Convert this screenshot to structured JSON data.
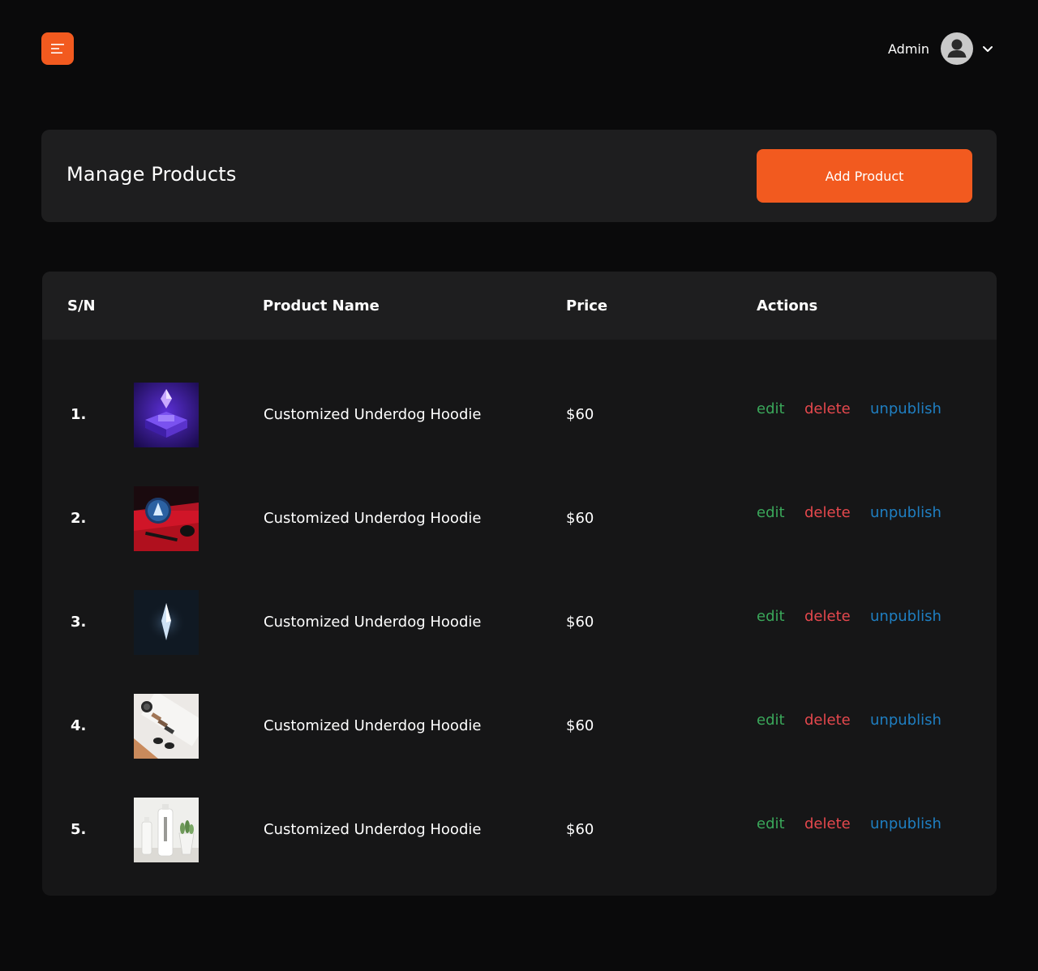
{
  "topbar": {
    "menu_icon": "menu-icon",
    "user_name": "Admin",
    "avatar_icon": "user-avatar-icon",
    "dropdown_icon": "chevron-down-icon"
  },
  "header": {
    "title": "Manage Products",
    "add_button": "Add Product"
  },
  "table": {
    "columns": [
      "S/N",
      "Product Name",
      "Price",
      "Actions"
    ],
    "rows": [
      {
        "sn": "1.",
        "image": "purple crystal pedestal",
        "name": "Customized Underdog Hoodie",
        "price": "$60",
        "edit": "edit",
        "delete": "delete",
        "unpublish": "unpublish"
      },
      {
        "sn": "2.",
        "image": "blue crystal ball with red light",
        "name": "Customized Underdog Hoodie",
        "price": "$60",
        "edit": "edit",
        "delete": "delete",
        "unpublish": "unpublish"
      },
      {
        "sn": "3.",
        "image": "glowing crystal shard on dark",
        "name": "Customized Underdog Hoodie",
        "price": "$60",
        "edit": "edit",
        "delete": "delete",
        "unpublish": "unpublish"
      },
      {
        "sn": "4.",
        "image": "accessories tray flat lay",
        "name": "Customized Underdog Hoodie",
        "price": "$60",
        "edit": "edit",
        "delete": "delete",
        "unpublish": "unpublish"
      },
      {
        "sn": "5.",
        "image": "white cosmetic bottles with plant",
        "name": "Customized Underdog Hoodie",
        "price": "$60",
        "edit": "edit",
        "delete": "delete",
        "unpublish": "unpublish"
      }
    ]
  },
  "colors": {
    "accent": "#f25a1f",
    "background": "#0a0a0b",
    "card": "#1e1e1f",
    "table_body": "#161617",
    "edit": "#3aa75a",
    "delete": "#e5484d",
    "unpublish": "#1f7fc2"
  }
}
